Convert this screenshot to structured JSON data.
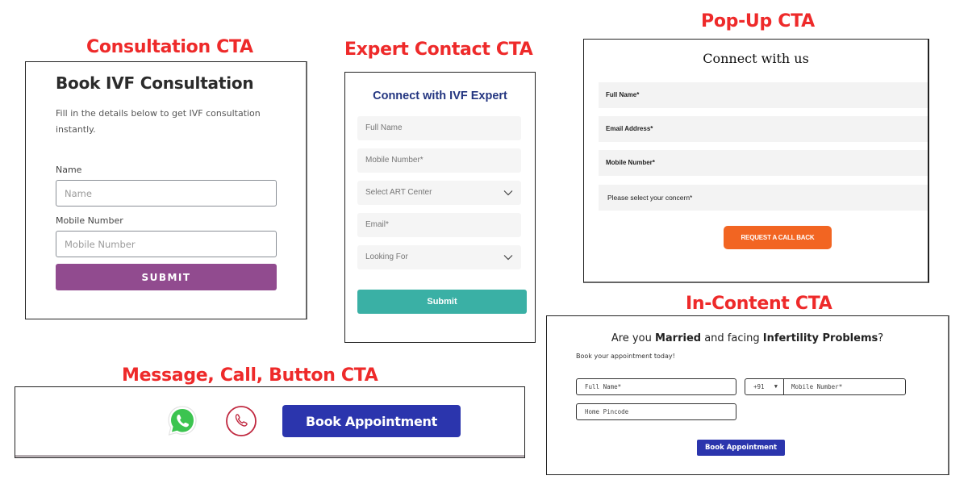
{
  "sections": {
    "consultation": {
      "label": "Consultation CTA",
      "title": "Book IVF Consultation",
      "description": "Fill in the details below to get IVF consultation instantly.",
      "name_label": "Name",
      "name_placeholder": "Name",
      "mobile_label": "Mobile Number",
      "mobile_placeholder": "Mobile Number",
      "submit_label": "SUBMIT",
      "button_color": "#914b8f"
    },
    "expert_contact": {
      "label": "Expert Contact CTA",
      "title": "Connect with IVF Expert",
      "fields": [
        {
          "placeholder": "Full Name",
          "type": "text"
        },
        {
          "placeholder": "Mobile Number*",
          "type": "text"
        },
        {
          "placeholder": "Select ART Center",
          "type": "select"
        },
        {
          "placeholder": "Email*",
          "type": "text"
        },
        {
          "placeholder": "Looking For",
          "type": "select"
        }
      ],
      "submit_label": "Submit",
      "title_color": "#233580",
      "button_color": "#3ab0a5"
    },
    "popup": {
      "label": "Pop-Up CTA",
      "title": "Connect with us",
      "fields": [
        {
          "placeholder": "Full Name*"
        },
        {
          "placeholder": "Email Address*"
        },
        {
          "placeholder": "Mobile Number*"
        },
        {
          "placeholder": "Please select your concern*"
        }
      ],
      "submit_label": "REQUEST A CALL BACK",
      "button_color": "#f26522"
    },
    "in_content": {
      "label": "In-Content CTA",
      "title_parts": {
        "p1": "Are you ",
        "b1": "Married",
        "p2": " and facing ",
        "b2": "Infertility Problems",
        "p3": "?"
      },
      "subtitle": "Book your appointment today!",
      "full_name_placeholder": "Full Name*",
      "country_code": "+91",
      "mobile_placeholder": "Mobile Number*",
      "pincode_placeholder": "Home Pincode",
      "submit_label": "Book Appointment",
      "button_color": "#2b35ad"
    },
    "message_call": {
      "label": "Message, Call, Button CTA",
      "whatsapp_icon": "whatsapp-icon",
      "call_icon": "phone-call-icon",
      "button_label": "Book Appointment",
      "button_color": "#2b35ad"
    }
  },
  "accent_label_color": "#ee2a2a"
}
